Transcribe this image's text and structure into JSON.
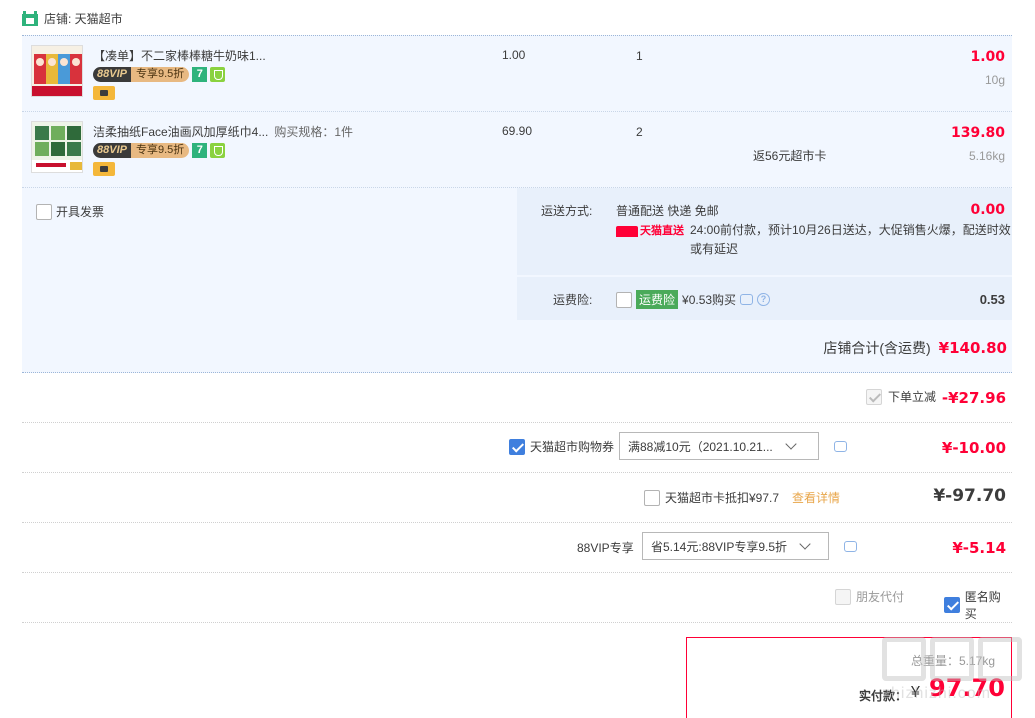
{
  "shop": {
    "label": "店铺: 天猫超市"
  },
  "items": [
    {
      "title": "【凑单】不二家棒棒糖牛奶味1...",
      "spec": "",
      "vip_left": "88VIP",
      "vip_right": "专享9.5折",
      "icon7": "7",
      "price": "1.00",
      "qty": "1",
      "extra": "",
      "total": "1.00",
      "weight": "10g"
    },
    {
      "title": "洁柔抽纸Face油画风加厚纸巾4...",
      "spec": "购买规格：1件",
      "vip_left": "88VIP",
      "vip_right": "专享9.5折",
      "icon7": "7",
      "price": "69.90",
      "qty": "2",
      "extra": "返56元超市卡",
      "total": "139.80",
      "weight": "5.16kg"
    }
  ],
  "invoice": {
    "label": "开具发票"
  },
  "shipping": {
    "label": "运送方式:",
    "method": "普通配送 快递 免邮",
    "tmall_direct": "天猫直送",
    "desc": "24:00前付款，预计10月26日送达，大促销售火爆，配送时效或有延迟",
    "cost": "0.00"
  },
  "insurance": {
    "label": "运费险:",
    "tag": "运费险",
    "text": "¥0.53购买",
    "cost": "0.53"
  },
  "shop_total": {
    "label": "店铺合计(含运费)",
    "value": "¥140.80"
  },
  "discount": {
    "label": "下单立减",
    "value": "-¥27.96"
  },
  "coupon": {
    "label": "天猫超市购物券",
    "selected": "满88减10元（2021.10.21...",
    "value": "¥-10.00"
  },
  "market_card": {
    "label": "天猫超市卡抵扣¥97.7",
    "link": "查看详情",
    "value": "¥-97.70"
  },
  "vip": {
    "label": "88VIP专享",
    "selected": "省5.14元:88VIP专享9.5折",
    "value": "¥-5.14"
  },
  "options": {
    "friend_pay": "朋友代付",
    "anonymous": "匿名购买"
  },
  "payment": {
    "weight_text": "总重量：5.17kg",
    "label": "实付款：",
    "currency": "¥",
    "amount": "97.70"
  },
  "watermark": {
    "text": "zhizhizhi.com"
  },
  "colors": {
    "accent": "#ff0036",
    "panel": "#f2f7ff",
    "checkbox": "#3f7fde"
  }
}
